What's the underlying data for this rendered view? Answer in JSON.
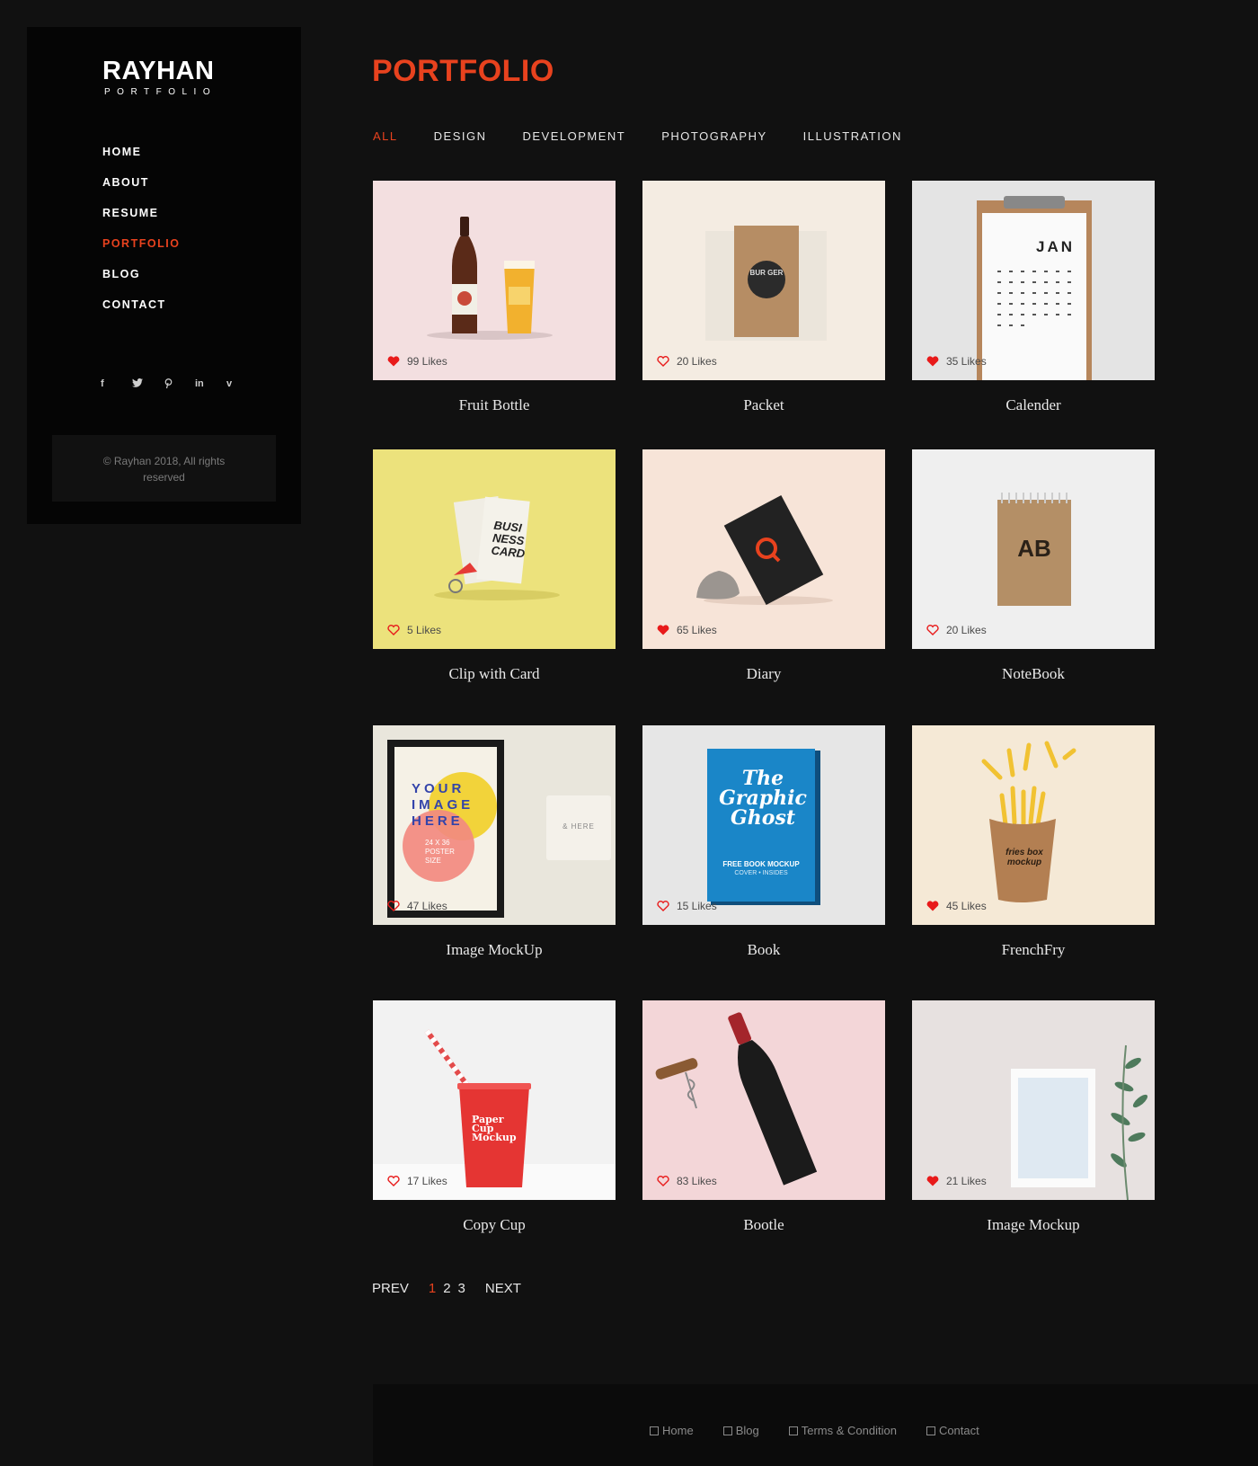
{
  "brand": {
    "name": "RAYHAN",
    "tagline": "PORTFOLIO"
  },
  "nav": [
    "HOME",
    "ABOUT",
    "RESUME",
    "PORTFOLIO",
    "BLOG",
    "CONTACT"
  ],
  "social": [
    "f",
    "t",
    "p",
    "in",
    "v"
  ],
  "copyright": "© Rayhan 2018, All rights reserved",
  "page_title": "PORTFOLIO",
  "filters": [
    "ALL",
    "DESIGN",
    "DEVELOPMENT",
    "PHOTOGRAPHY",
    "ILLUSTRATION"
  ],
  "items": [
    {
      "title": "Fruit Bottle",
      "likes": "99 Likes",
      "liked": true,
      "bg": "#f3dfe0"
    },
    {
      "title": "Packet",
      "likes": "20 Likes",
      "liked": false,
      "bg": "#f4ece2"
    },
    {
      "title": "Calender",
      "likes": "35 Likes",
      "liked": true,
      "bg": "#e4e4e4"
    },
    {
      "title": "Clip with Card",
      "likes": "5 Likes",
      "liked": false,
      "bg": "#ece27c"
    },
    {
      "title": "Diary",
      "likes": "65 Likes",
      "liked": true,
      "bg": "#f7e4d8"
    },
    {
      "title": "NoteBook",
      "likes": "20 Likes",
      "liked": false,
      "bg": "#efefef"
    },
    {
      "title": "Image MockUp",
      "likes": "47 Likes",
      "liked": false,
      "bg": "#e9e6dc"
    },
    {
      "title": "Book",
      "likes": "15 Likes",
      "liked": false,
      "bg": "#e6e6e6"
    },
    {
      "title": "FrenchFry",
      "likes": "45 Likes",
      "liked": true,
      "bg": "#f5e9d6"
    },
    {
      "title": "Copy Cup",
      "likes": "17 Likes",
      "liked": false,
      "bg": "#f2f2f2"
    },
    {
      "title": "Bootle",
      "likes": "83 Likes",
      "liked": false,
      "bg": "#f3d6d8"
    },
    {
      "title": "Image Mockup",
      "likes": "21 Likes",
      "liked": true,
      "bg": "#e7e1e0"
    }
  ],
  "artwork": {
    "calendar_month": "JAN",
    "card_text": "BUSI NESS CARD",
    "poster_text": [
      "YOUR",
      "IMAGE",
      "HERE"
    ],
    "poster_size": "24 X 36 POSTER SIZE",
    "plaque_text": "& HERE",
    "book_title": "The Graphic Ghost",
    "book_caption": "FREE BOOK MOCKUP",
    "book_sub": "COVER • INSIDES",
    "cup_text": "Paper Cup Mockup",
    "fries_text": "fries box mockup",
    "notebook_mark": "AB",
    "packet_text": "BUR GER"
  },
  "pagination": {
    "prev": "PREV",
    "pages": [
      "1",
      "2",
      "3"
    ],
    "next": "NEXT",
    "current": "1"
  },
  "footer": [
    "Home",
    "Blog",
    "Terms & Condition",
    "Contact"
  ],
  "colors": {
    "accent": "#e8421e",
    "background": "#111111",
    "sidebar": "#050505"
  }
}
